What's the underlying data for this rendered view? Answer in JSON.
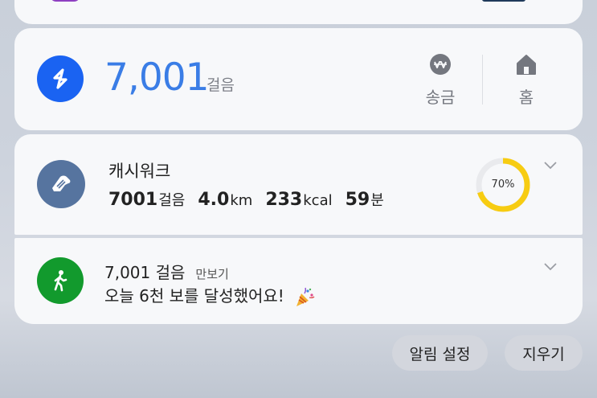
{
  "steps_widget": {
    "count": "7,001",
    "unit": "걸음",
    "actions": [
      {
        "label": "송금",
        "icon": "transfer-icon"
      },
      {
        "label": "홈",
        "icon": "home-icon"
      }
    ]
  },
  "cashwalk": {
    "title": "캐시워크",
    "stats": [
      {
        "value": "7001",
        "unit": "걸음"
      },
      {
        "value": "4.0",
        "unit": "km"
      },
      {
        "value": "233",
        "unit": "kcal"
      },
      {
        "value": "59",
        "unit": "분"
      }
    ],
    "progress": {
      "percent": 70,
      "label": "70%"
    },
    "ring_color": "#f7cc12"
  },
  "pedometer": {
    "title": "7,001 걸음",
    "app": "만보기",
    "message": "오늘 6천 보를 달성했어요!",
    "icon": "walking-person-icon",
    "accent": "#129a2d"
  },
  "footer": {
    "settings_label": "알림 설정",
    "clear_label": "지우기"
  },
  "colors": {
    "steps_logo": "#1a63f2",
    "steps_count": "#3a7de6",
    "cashwalk_icon_bg": "#56749f"
  }
}
